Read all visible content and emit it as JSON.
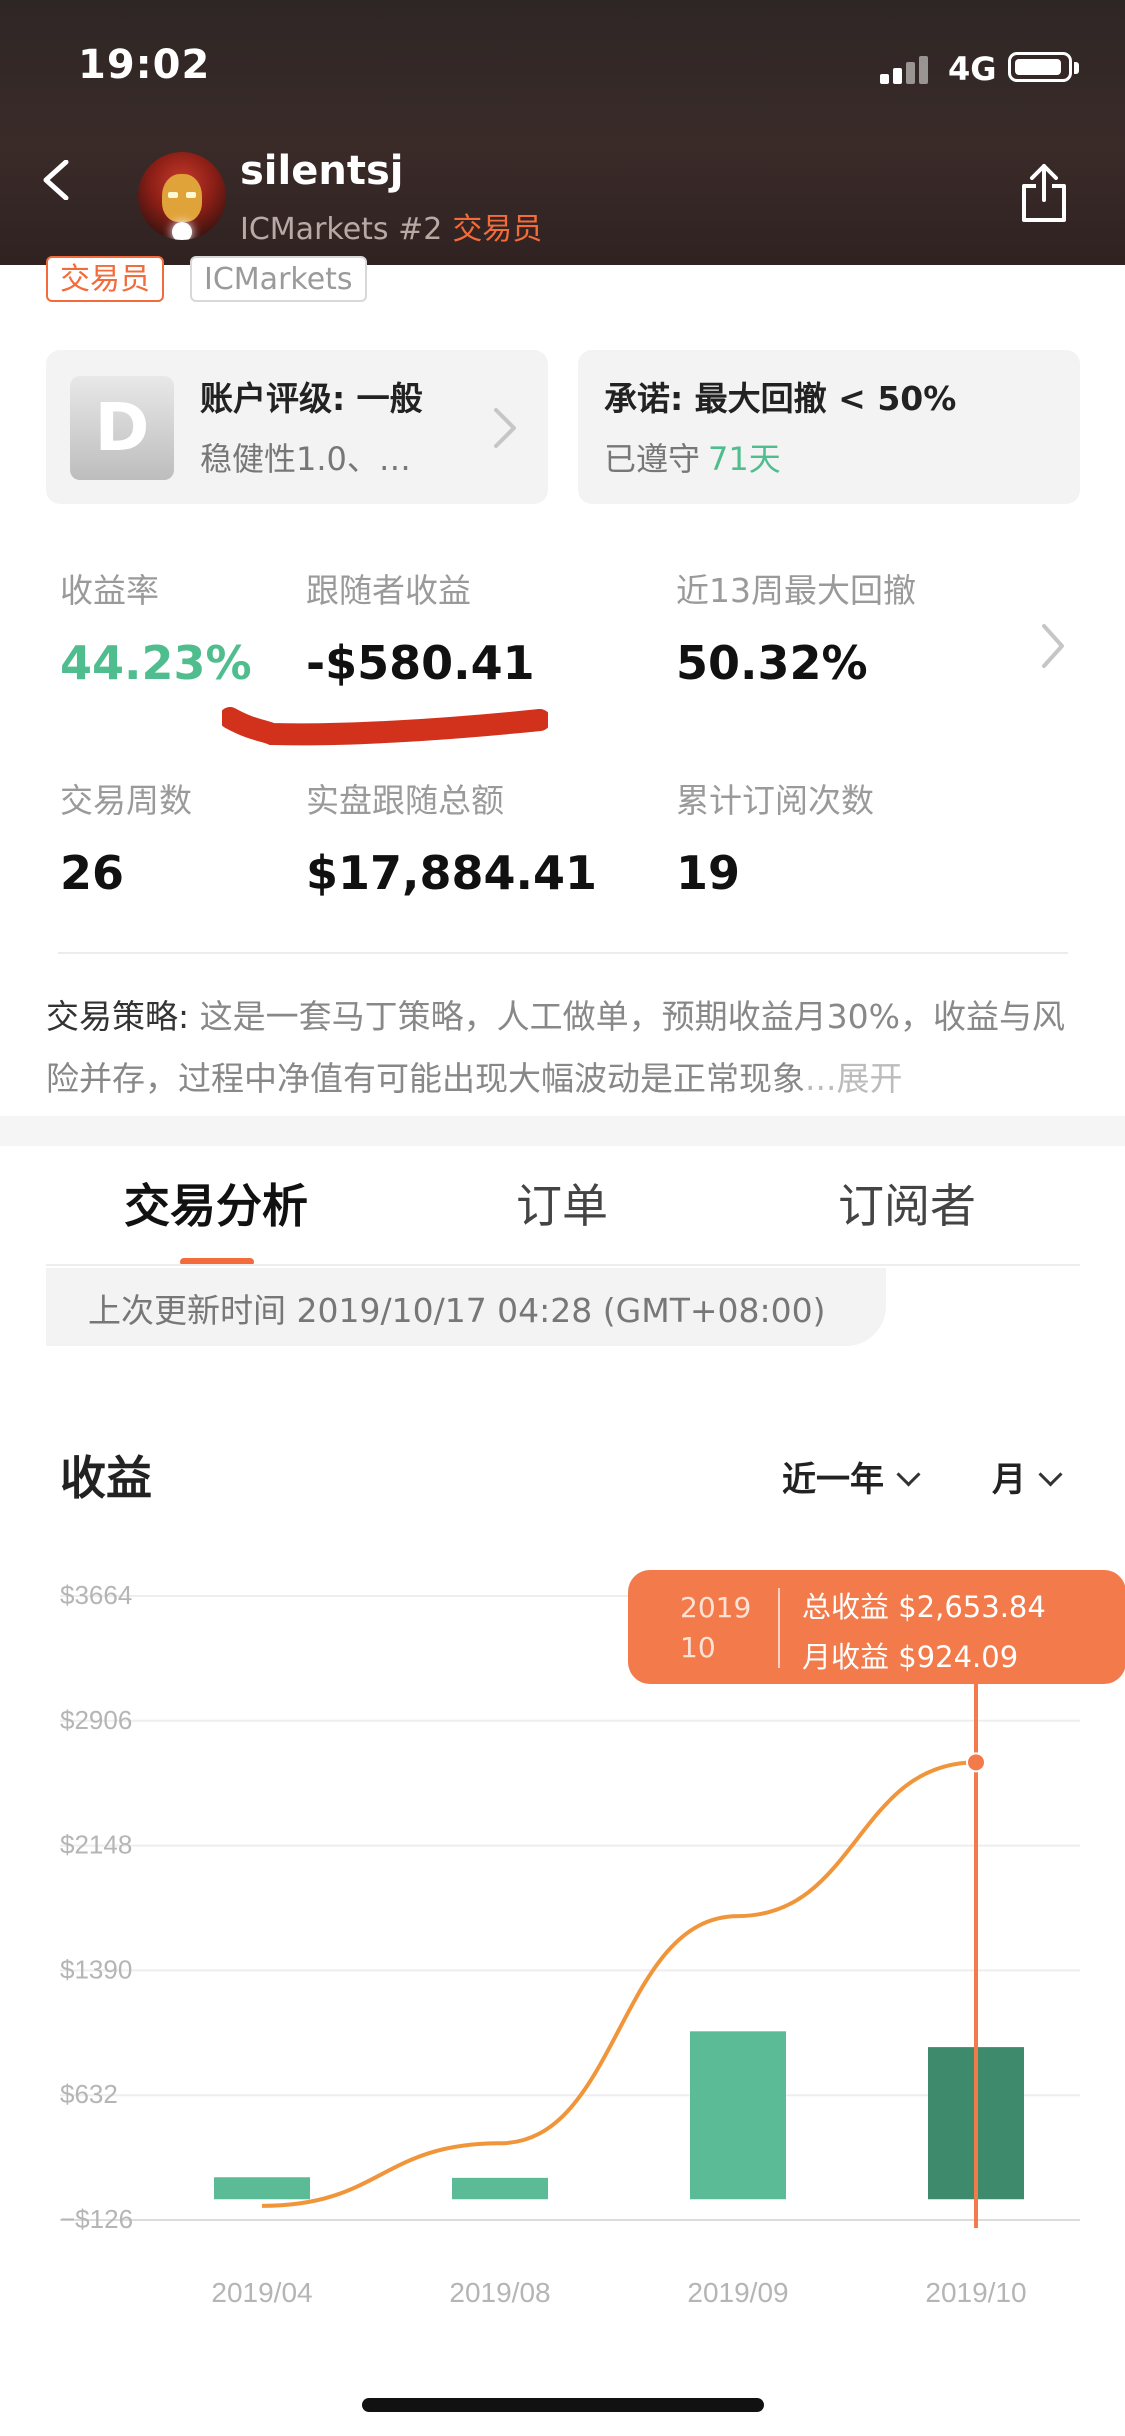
{
  "status_bar": {
    "time": "19:02",
    "network": "4G",
    "battery_pct": 88
  },
  "header": {
    "back_icon": "chevron-left-icon",
    "username": "silentsj",
    "broker_rank": "ICMarkets #2",
    "role": "交易员",
    "share_icon": "share-icon"
  },
  "tags": [
    "交易员",
    "ICMarkets"
  ],
  "rating_card": {
    "grade": "D",
    "title": "账户评级: 一般",
    "subtitle": "稳健性1.0、…"
  },
  "promise_card": {
    "title": "承诺: 最大回撤 < 50%",
    "subtitle": "已遵守",
    "days": "71天"
  },
  "stats": [
    {
      "label": "收益率",
      "value": "44.23%"
    },
    {
      "label": "跟随者收益",
      "value": "-$580.41"
    },
    {
      "label": "近13周最大回撤",
      "value": "50.32%"
    },
    {
      "label": "交易周数",
      "value": "26"
    },
    {
      "label": "实盘跟随总额",
      "value": "$17,884.41"
    },
    {
      "label": "累计订阅次数",
      "value": "19"
    }
  ],
  "strategy": {
    "label": "交易策略:",
    "text": " 这是一套马丁策略，人工做单，预期收益月30%，收益与风险并存，过程中净值有可能出现大幅波动是正常现象",
    "more": "...展开"
  },
  "tabs": [
    "交易分析",
    "订单",
    "订阅者"
  ],
  "update_text": "上次更新时间 2019/10/17 04:28 (GMT+08:00)",
  "profit": {
    "title": "收益",
    "range": "近一年",
    "period": "月"
  },
  "tooltip": {
    "year": "2019",
    "month": "10",
    "total": "总收益 $2,653.84",
    "monthly": "月收益 $924.09"
  },
  "colors": {
    "accent": "#f36b3a",
    "green": "#4fbd8e",
    "bar": "#5bbb96",
    "bar_selected": "#3d8a6c",
    "line": "#f0953a"
  },
  "chart_data": {
    "type": "bar",
    "categories": [
      "2019/04",
      "2019/08",
      "2019/09",
      "2019/10"
    ],
    "series": [
      {
        "name": "月收益",
        "type": "bar",
        "values": [
          -40,
          130,
          1020,
          924.09
        ]
      },
      {
        "name": "总收益",
        "type": "line",
        "values": [
          -40,
          340,
          1720,
          2653.84
        ]
      }
    ],
    "yticks": [
      "$3664",
      "$2906",
      "$2148",
      "$1390",
      "$632",
      "−$126"
    ],
    "ylim": [
      -126,
      3664
    ],
    "selected_index": 3,
    "grid": true
  }
}
